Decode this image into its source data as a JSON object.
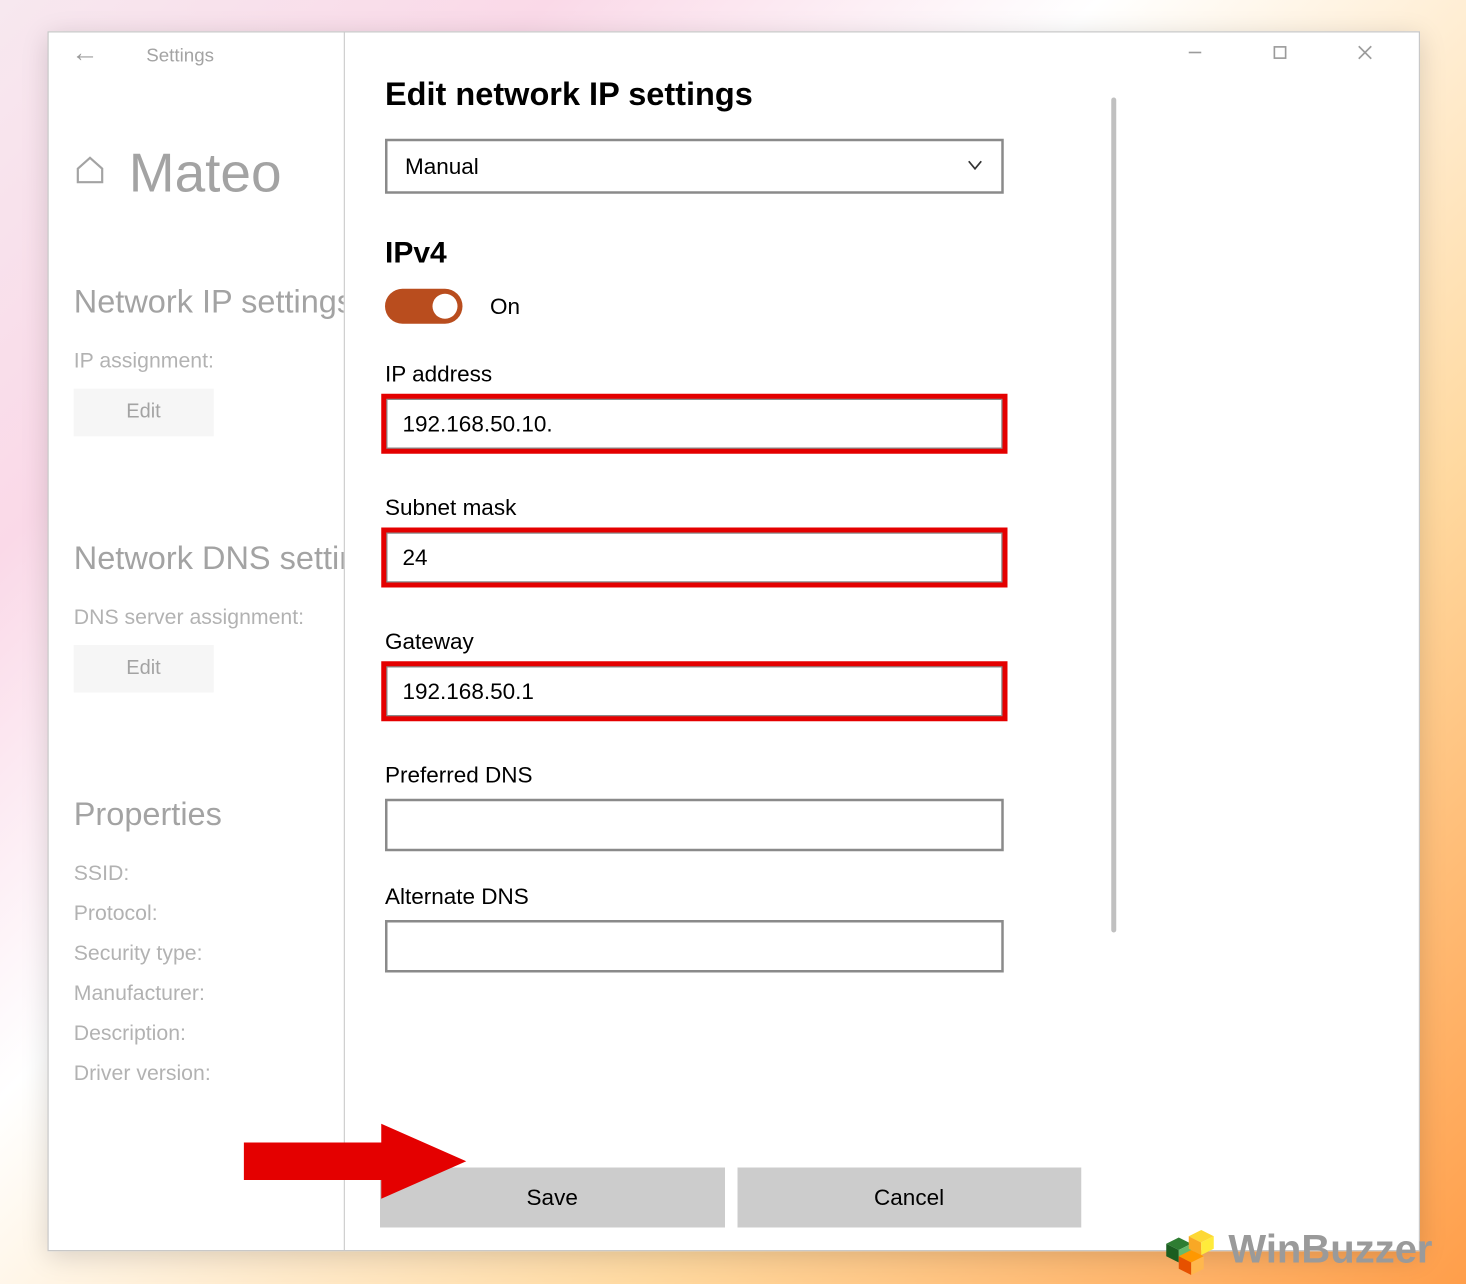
{
  "window": {
    "app_label": "Settings",
    "home_name": "Mateo"
  },
  "bg": {
    "section_net_ip": "Network IP settings",
    "ip_assignment_label": "IP assignment:",
    "edit_label": "Edit",
    "section_net_dns": "Network DNS settings",
    "dns_assignment_label": "DNS server assignment:",
    "section_properties": "Properties",
    "props": {
      "ssid": "SSID:",
      "protocol": "Protocol:",
      "security_type": "Security type:",
      "manufacturer": "Manufacturer:",
      "description": "Description:",
      "driver_version": "Driver version:"
    }
  },
  "dialog": {
    "title": "Edit network IP settings",
    "mode_selected": "Manual",
    "ipv4_heading": "IPv4",
    "toggle_state": "On",
    "fields": {
      "ip_address": {
        "label": "IP address",
        "value": "192.168.50.10."
      },
      "subnet_mask": {
        "label": "Subnet mask",
        "value": "24"
      },
      "gateway": {
        "label": "Gateway",
        "value": "192.168.50.1"
      },
      "preferred_dns": {
        "label": "Preferred DNS",
        "value": ""
      },
      "alternate_dns": {
        "label": "Alternate DNS",
        "value": ""
      }
    },
    "save_label": "Save",
    "cancel_label": "Cancel"
  },
  "watermark": "WinBuzzer"
}
